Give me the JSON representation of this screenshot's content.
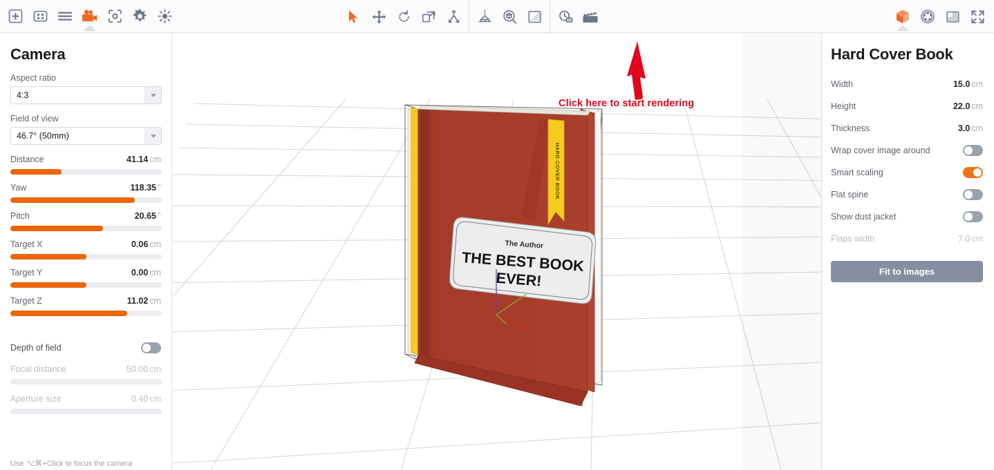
{
  "toolbar": {
    "left_items": [
      {
        "name": "add-icon",
        "label": "Add",
        "active": false
      },
      {
        "name": "materials-grid-icon",
        "label": "Materials",
        "active": false
      },
      {
        "name": "list-icon",
        "label": "Scene list",
        "active": false
      },
      {
        "name": "camera-icon",
        "label": "Camera",
        "active": true
      },
      {
        "name": "focus-target-icon",
        "label": "Focus",
        "active": false
      },
      {
        "name": "gear-icon",
        "label": "Settings",
        "active": false
      },
      {
        "name": "light-icon",
        "label": "Environment",
        "active": false
      }
    ],
    "center_items": [
      {
        "name": "cursor-select-icon",
        "label": "Select",
        "active": true
      },
      {
        "name": "move-icon",
        "label": "Move",
        "active": false
      },
      {
        "name": "rotate-icon",
        "label": "Rotate",
        "active": false
      },
      {
        "name": "scale-icon",
        "label": "Scale",
        "active": false
      },
      {
        "name": "distribute-icon",
        "label": "Distribute",
        "active": false
      },
      {
        "name": "perspective-icon",
        "label": "Perspective",
        "active": false
      },
      {
        "name": "zoom-object-icon",
        "label": "Zoom to object",
        "active": false
      },
      {
        "name": "shading-icon",
        "label": "Shading",
        "active": false
      },
      {
        "name": "render-preview-icon",
        "label": "Render preview",
        "active": false
      },
      {
        "name": "render-movie-icon",
        "label": "Start rendering",
        "active": false
      }
    ],
    "right_items": [
      {
        "name": "object-cube-icon",
        "label": "Object",
        "active": true
      },
      {
        "name": "environment-sphere-icon",
        "label": "Environment",
        "active": false
      },
      {
        "name": "backdrop-icon",
        "label": "Backdrop",
        "active": false
      },
      {
        "name": "fullscreen-icon",
        "label": "Fullscreen",
        "active": false
      }
    ]
  },
  "camera_panel": {
    "title": "Camera",
    "aspect_ratio": {
      "label": "Aspect ratio",
      "value": "4:3"
    },
    "field_of_view": {
      "label": "Field of view",
      "value": "46.7° (50mm)"
    },
    "sliders": [
      {
        "label": "Distance",
        "value": "41.14",
        "unit": "cm",
        "fill": 34
      },
      {
        "label": "Yaw",
        "value": "118.35",
        "unit": "°",
        "fill": 82
      },
      {
        "label": "Pitch",
        "value": "20.65",
        "unit": "°",
        "fill": 61
      },
      {
        "label": "Target X",
        "value": "0.06",
        "unit": "cm",
        "fill": 50
      },
      {
        "label": "Target Y",
        "value": "0.00",
        "unit": "cm",
        "fill": 50
      },
      {
        "label": "Target Z",
        "value": "11.02",
        "unit": "cm",
        "fill": 77
      }
    ],
    "depth_of_field": {
      "label": "Depth of field",
      "enabled": false
    },
    "focal_distance": {
      "label": "Focal distance",
      "value": "50.00",
      "unit": "cm",
      "fill": 0
    },
    "aperture_size": {
      "label": "Aperture size",
      "value": "0.40",
      "unit": "cm",
      "fill": 0
    },
    "hint": "Use ⌥⌘+Click to focus the camera"
  },
  "object_panel": {
    "title": "Hard Cover Book",
    "properties": [
      {
        "label": "Width",
        "value": "15.0",
        "unit": "cm",
        "dim": false
      },
      {
        "label": "Height",
        "value": "22.0",
        "unit": "cm",
        "dim": false
      },
      {
        "label": "Thickness",
        "value": "3.0",
        "unit": "cm",
        "dim": false
      }
    ],
    "toggles": [
      {
        "label": "Wrap cover image around",
        "enabled": false
      },
      {
        "label": "Smart scaling",
        "enabled": true
      },
      {
        "label": "Flat spine",
        "enabled": false
      },
      {
        "label": "Show dust jacket",
        "enabled": false
      }
    ],
    "flaps_width": {
      "label": "Flaps width",
      "value": "7.0",
      "unit": "cm",
      "dim": true
    },
    "fit_button": "Fit to images"
  },
  "viewport": {
    "annotation": "Click here to start rendering",
    "book": {
      "author": "The Author",
      "title_line1": "THE BEST BOOK",
      "title_line2": "EVER!",
      "ribbon_text": "HARD COVER BOOK"
    },
    "colors": {
      "cover": "#a63b2a",
      "cover_shade": "#8d3223",
      "spine": "#b24430",
      "ribbon": "#f5cc1e",
      "ribbon_shade": "#d9b018",
      "pages": "#f7f5f0",
      "grid": "#d2d4d7",
      "accent": "#ec6608",
      "annotation": "#e2041b"
    }
  }
}
